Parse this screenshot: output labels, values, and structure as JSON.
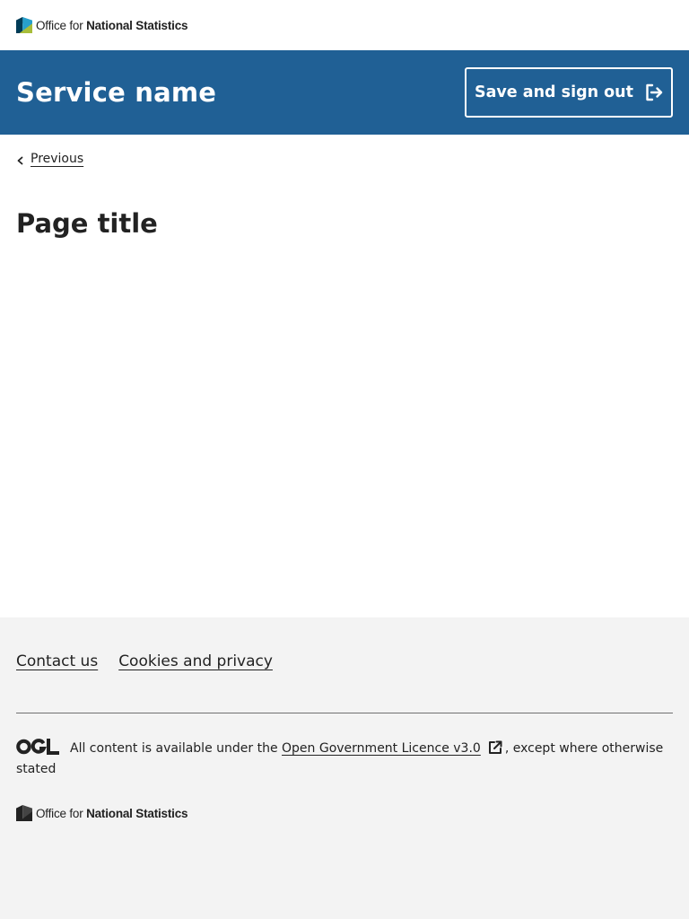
{
  "header": {
    "logo": {
      "brand_prefix": "Office for ",
      "brand_strong": "National Statistics",
      "icon": "ons-logo-icon",
      "colors": [
        "#003c57",
        "#a8bd3a",
        "#27a0cc"
      ]
    }
  },
  "masthead": {
    "service_name": "Service name",
    "signout_label": "Save and sign out",
    "signout_icon": "sign-out-icon",
    "background": "#206095"
  },
  "main": {
    "previous_label": "Previous",
    "page_title": "Page title"
  },
  "footer": {
    "links": [
      "Contact us",
      "Cookies and privacy"
    ],
    "licence": {
      "ogl_icon": "ogl-logo-icon",
      "prefix": "All content is available under the ",
      "link_text": "Open Government Licence v3.0",
      "suffix": ", except where otherwise stated"
    },
    "logo": {
      "brand_prefix": "Office for ",
      "brand_strong": "National Statistics"
    },
    "background": "#f3f3f3"
  }
}
